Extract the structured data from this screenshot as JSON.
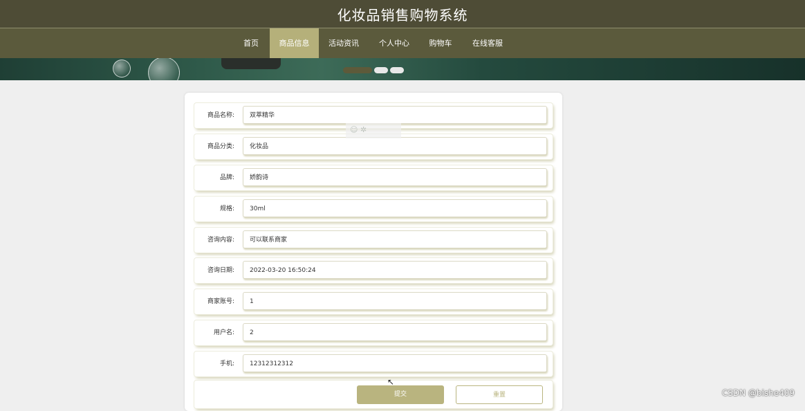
{
  "header": {
    "title": "化妆品销售购物系统"
  },
  "nav": {
    "items": [
      {
        "label": "首页"
      },
      {
        "label": "商品信息"
      },
      {
        "label": "活动资讯"
      },
      {
        "label": "个人中心"
      },
      {
        "label": "购物车"
      },
      {
        "label": "在线客服"
      }
    ],
    "active_index": 1
  },
  "form": {
    "fields": [
      {
        "label": "商品名称:",
        "value": "双萃精华"
      },
      {
        "label": "商品分类:",
        "value": "化妆品"
      },
      {
        "label": "品牌:",
        "value": "娇韵诗"
      },
      {
        "label": "规格:",
        "value": "30ml"
      },
      {
        "label": "咨询内容:",
        "value": "可以联系商家"
      },
      {
        "label": "咨询日期:",
        "value": "2022-03-20 16:50:24"
      },
      {
        "label": "商家账号:",
        "value": "1"
      },
      {
        "label": "用户名:",
        "value": "2"
      },
      {
        "label": "手机:",
        "value": "12312312312"
      }
    ],
    "submit_label": "提交",
    "reset_label": "重置"
  },
  "watermark": {
    "text": "CSDN @bishe409"
  },
  "colors": {
    "header_bg": "#4e4c36",
    "nav_bg": "#5b5a3c",
    "accent": "#b5b07a"
  }
}
